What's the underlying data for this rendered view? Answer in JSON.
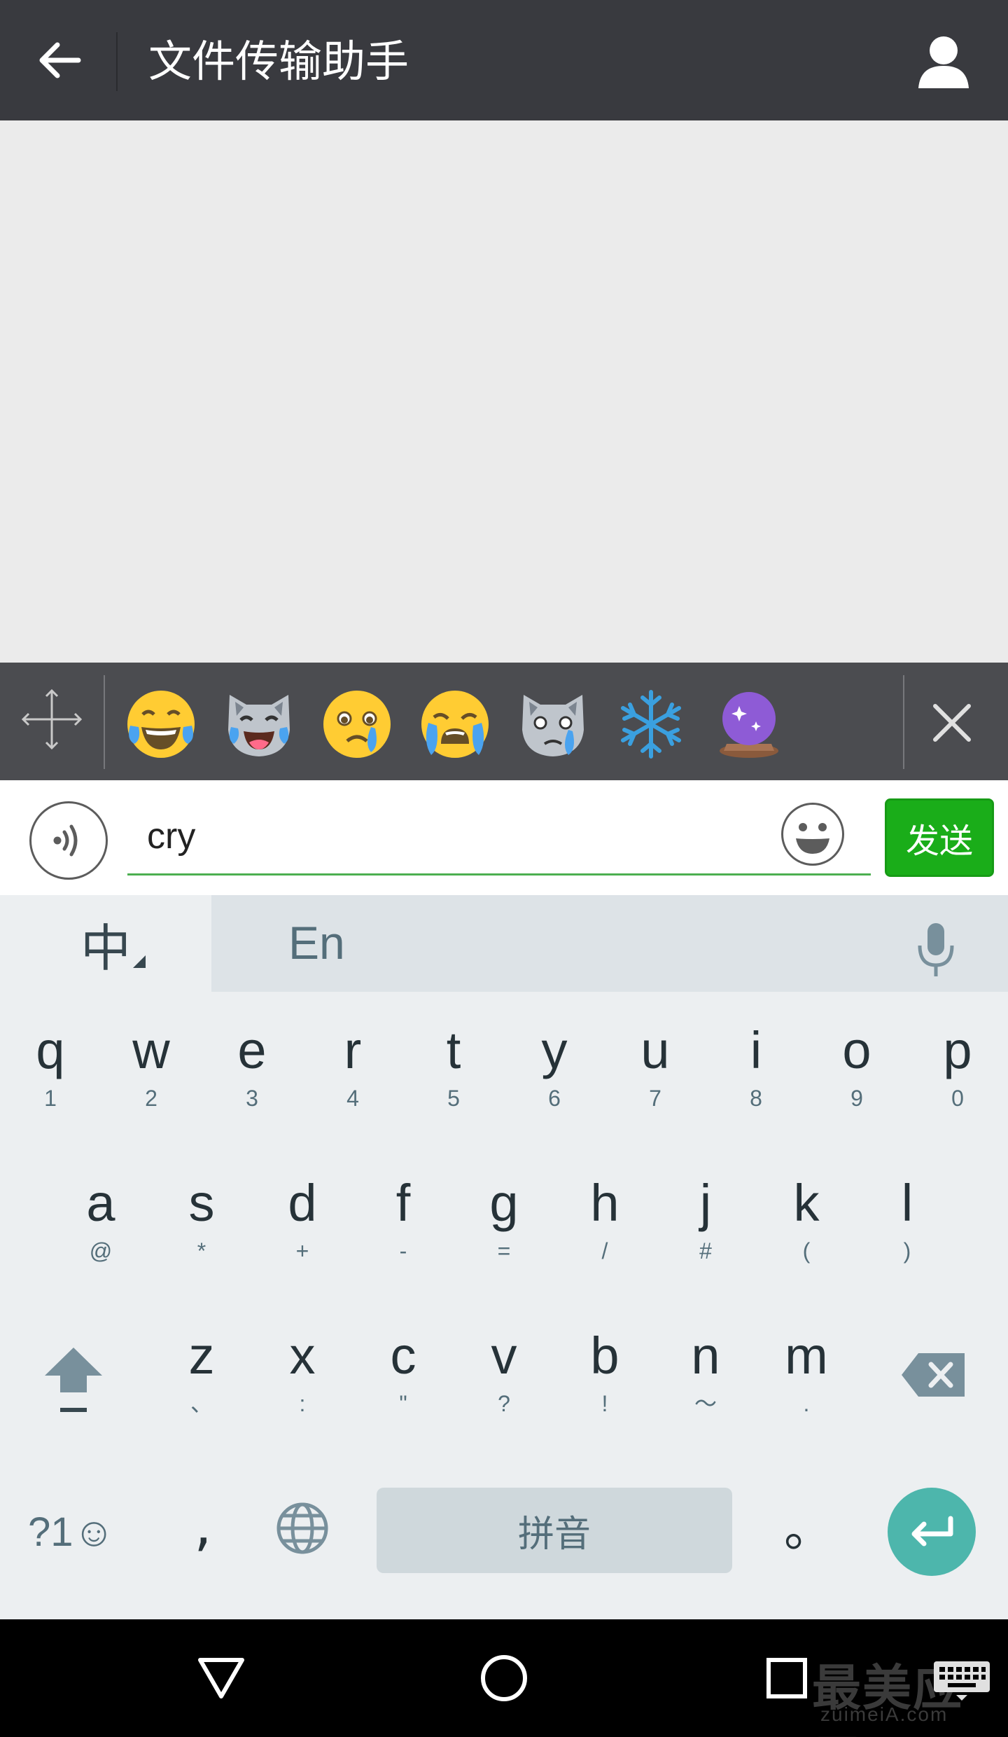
{
  "header": {
    "title": "文件传输助手"
  },
  "emoji_strip": {
    "items": [
      {
        "name": "face-tears-of-joy"
      },
      {
        "name": "cat-tears-of-joy"
      },
      {
        "name": "crying-face"
      },
      {
        "name": "weary-face"
      },
      {
        "name": "crying-cat"
      },
      {
        "name": "snowflake"
      },
      {
        "name": "crystal-ball"
      }
    ]
  },
  "composer": {
    "text_value": "cry",
    "send_label": "发送"
  },
  "keyboard": {
    "lang_label": "中",
    "suggestion": "En",
    "row1": [
      {
        "k": "q",
        "s": "1"
      },
      {
        "k": "w",
        "s": "2"
      },
      {
        "k": "e",
        "s": "3"
      },
      {
        "k": "r",
        "s": "4"
      },
      {
        "k": "t",
        "s": "5"
      },
      {
        "k": "y",
        "s": "6"
      },
      {
        "k": "u",
        "s": "7"
      },
      {
        "k": "i",
        "s": "8"
      },
      {
        "k": "o",
        "s": "9"
      },
      {
        "k": "p",
        "s": "0"
      }
    ],
    "row2": [
      {
        "k": "a",
        "s": "@"
      },
      {
        "k": "s",
        "s": "*"
      },
      {
        "k": "d",
        "s": "+"
      },
      {
        "k": "f",
        "s": "-"
      },
      {
        "k": "g",
        "s": "="
      },
      {
        "k": "h",
        "s": "/"
      },
      {
        "k": "j",
        "s": "#"
      },
      {
        "k": "k",
        "s": "("
      },
      {
        "k": "l",
        "s": ")"
      }
    ],
    "row3": [
      {
        "k": "z",
        "s": "、"
      },
      {
        "k": "x",
        "s": ":"
      },
      {
        "k": "c",
        "s": "\""
      },
      {
        "k": "v",
        "s": "?"
      },
      {
        "k": "b",
        "s": "!"
      },
      {
        "k": "n",
        "s": "～"
      },
      {
        "k": "m",
        "s": "."
      }
    ],
    "sym_label": "?1☺",
    "comma": ",",
    "space_label": "拼音",
    "period": "。"
  },
  "watermark": {
    "brand": "最美应用",
    "domain": "zuimeiA.com"
  },
  "colors": {
    "appbar": "#393a3f",
    "send_green": "#1aad19",
    "enter_teal": "#4db6ac"
  }
}
